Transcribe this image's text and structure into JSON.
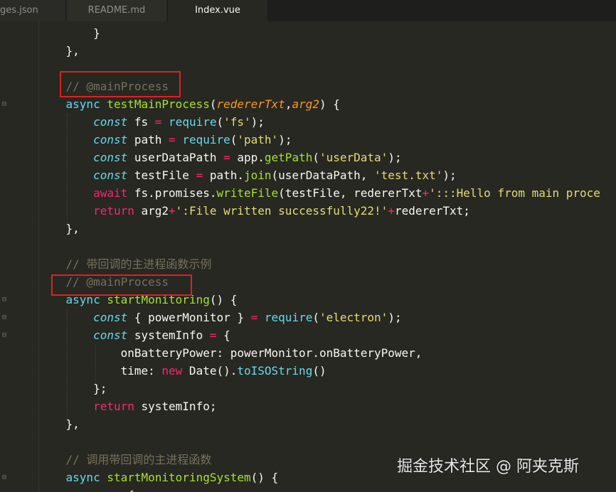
{
  "tabs": [
    {
      "label": "ges.json"
    },
    {
      "label": "README.md"
    },
    {
      "label": "Index.vue"
    }
  ],
  "code_lines": [
    [
      {
        "t": "        }",
        "c": "plain"
      }
    ],
    [
      {
        "t": "    },",
        "c": "plain"
      }
    ],
    [
      {
        "t": "",
        "c": "plain"
      }
    ],
    [
      {
        "t": "    // @mainProcess",
        "c": "cmt"
      }
    ],
    [
      {
        "t": "    ",
        "c": "plain"
      },
      {
        "t": "async",
        "c": "kw"
      },
      {
        "t": " ",
        "c": "plain"
      },
      {
        "t": "testMainProcess",
        "c": "fn"
      },
      {
        "t": "(",
        "c": "plain"
      },
      {
        "t": "redererTxt",
        "c": "param"
      },
      {
        "t": ",",
        "c": "plain"
      },
      {
        "t": "arg2",
        "c": "param"
      },
      {
        "t": ") {",
        "c": "plain"
      }
    ],
    [
      {
        "t": "        ",
        "c": "plain"
      },
      {
        "t": "const",
        "c": "kwi"
      },
      {
        "t": " fs ",
        "c": "plain"
      },
      {
        "t": "=",
        "c": "op"
      },
      {
        "t": " ",
        "c": "plain"
      },
      {
        "t": "require",
        "c": "kw"
      },
      {
        "t": "(",
        "c": "plain"
      },
      {
        "t": "'fs'",
        "c": "str"
      },
      {
        "t": ");",
        "c": "plain"
      }
    ],
    [
      {
        "t": "        ",
        "c": "plain"
      },
      {
        "t": "const",
        "c": "kwi"
      },
      {
        "t": " path ",
        "c": "plain"
      },
      {
        "t": "=",
        "c": "op"
      },
      {
        "t": " ",
        "c": "plain"
      },
      {
        "t": "require",
        "c": "kw"
      },
      {
        "t": "(",
        "c": "plain"
      },
      {
        "t": "'path'",
        "c": "str"
      },
      {
        "t": ");",
        "c": "plain"
      }
    ],
    [
      {
        "t": "        ",
        "c": "plain"
      },
      {
        "t": "const",
        "c": "kwi"
      },
      {
        "t": " userDataPath ",
        "c": "plain"
      },
      {
        "t": "=",
        "c": "op"
      },
      {
        "t": " app.",
        "c": "plain"
      },
      {
        "t": "getPath",
        "c": "fn"
      },
      {
        "t": "(",
        "c": "plain"
      },
      {
        "t": "'userData'",
        "c": "str"
      },
      {
        "t": ");",
        "c": "plain"
      }
    ],
    [
      {
        "t": "        ",
        "c": "plain"
      },
      {
        "t": "const",
        "c": "kwi"
      },
      {
        "t": " testFile ",
        "c": "plain"
      },
      {
        "t": "=",
        "c": "op"
      },
      {
        "t": " path.",
        "c": "plain"
      },
      {
        "t": "join",
        "c": "fn"
      },
      {
        "t": "(userDataPath, ",
        "c": "plain"
      },
      {
        "t": "'test.txt'",
        "c": "str"
      },
      {
        "t": ");",
        "c": "plain"
      }
    ],
    [
      {
        "t": "        ",
        "c": "plain"
      },
      {
        "t": "await",
        "c": "op"
      },
      {
        "t": " fs.promises.",
        "c": "plain"
      },
      {
        "t": "writeFile",
        "c": "fn"
      },
      {
        "t": "(testFile, redererTxt",
        "c": "plain"
      },
      {
        "t": "+",
        "c": "op"
      },
      {
        "t": "':::Hello from main proce",
        "c": "str"
      }
    ],
    [
      {
        "t": "        ",
        "c": "plain"
      },
      {
        "t": "return",
        "c": "op"
      },
      {
        "t": " arg2",
        "c": "plain"
      },
      {
        "t": "+",
        "c": "op"
      },
      {
        "t": "':File written successfully22!'",
        "c": "str"
      },
      {
        "t": "+",
        "c": "op"
      },
      {
        "t": "redererTxt;",
        "c": "plain"
      }
    ],
    [
      {
        "t": "    },",
        "c": "plain"
      }
    ],
    [
      {
        "t": "",
        "c": "plain"
      }
    ],
    [
      {
        "t": "    // 带回调的主进程函数示例",
        "c": "cmt"
      }
    ],
    [
      {
        "t": "    // @mainProcess",
        "c": "cmt"
      }
    ],
    [
      {
        "t": "    ",
        "c": "plain"
      },
      {
        "t": "async",
        "c": "kw"
      },
      {
        "t": " ",
        "c": "plain"
      },
      {
        "t": "startMonitoring",
        "c": "fn"
      },
      {
        "t": "() {",
        "c": "plain"
      }
    ],
    [
      {
        "t": "        ",
        "c": "plain"
      },
      {
        "t": "const",
        "c": "kwi"
      },
      {
        "t": " { powerMonitor } ",
        "c": "plain"
      },
      {
        "t": "=",
        "c": "op"
      },
      {
        "t": " ",
        "c": "plain"
      },
      {
        "t": "require",
        "c": "kw"
      },
      {
        "t": "(",
        "c": "plain"
      },
      {
        "t": "'electron'",
        "c": "str"
      },
      {
        "t": ");",
        "c": "plain"
      }
    ],
    [
      {
        "t": "        ",
        "c": "plain"
      },
      {
        "t": "const",
        "c": "kwi"
      },
      {
        "t": " systemInfo ",
        "c": "plain"
      },
      {
        "t": "=",
        "c": "op"
      },
      {
        "t": " {",
        "c": "plain"
      }
    ],
    [
      {
        "t": "            onBatteryPower: powerMonitor.onBatteryPower,",
        "c": "plain"
      }
    ],
    [
      {
        "t": "            time: ",
        "c": "plain"
      },
      {
        "t": "new",
        "c": "op"
      },
      {
        "t": " Date().",
        "c": "plain"
      },
      {
        "t": "toISOString",
        "c": "kw"
      },
      {
        "t": "()",
        "c": "plain"
      }
    ],
    [
      {
        "t": "        };",
        "c": "plain"
      }
    ],
    [
      {
        "t": "        ",
        "c": "plain"
      },
      {
        "t": "return",
        "c": "op"
      },
      {
        "t": " systemInfo;",
        "c": "plain"
      }
    ],
    [
      {
        "t": "    },",
        "c": "plain"
      }
    ],
    [
      {
        "t": "",
        "c": "plain"
      }
    ],
    [
      {
        "t": "    // 调用带回调的主进程函数",
        "c": "cmt"
      }
    ],
    [
      {
        "t": "    ",
        "c": "plain"
      },
      {
        "t": "async",
        "c": "kw"
      },
      {
        "t": " ",
        "c": "plain"
      },
      {
        "t": "startMonitoringSystem",
        "c": "fn"
      },
      {
        "t": "() {",
        "c": "plain"
      }
    ],
    [
      {
        "t": "        ",
        "c": "plain"
      },
      {
        "t": "c",
        "c": "kwi"
      },
      {
        "t": "    {",
        "c": "plain"
      }
    ]
  ],
  "fold_markers": [
    4,
    15,
    16,
    17,
    25
  ],
  "watermark": "掘金技术社区 @ 阿夹克斯",
  "colors": {
    "background": "#272822",
    "keyword": "#66d9ef",
    "function": "#a6e22e",
    "string": "#e6db74",
    "operator": "#f92672",
    "parameter": "#fd971f",
    "comment": "#75715e",
    "highlight_box": "#e02020"
  }
}
